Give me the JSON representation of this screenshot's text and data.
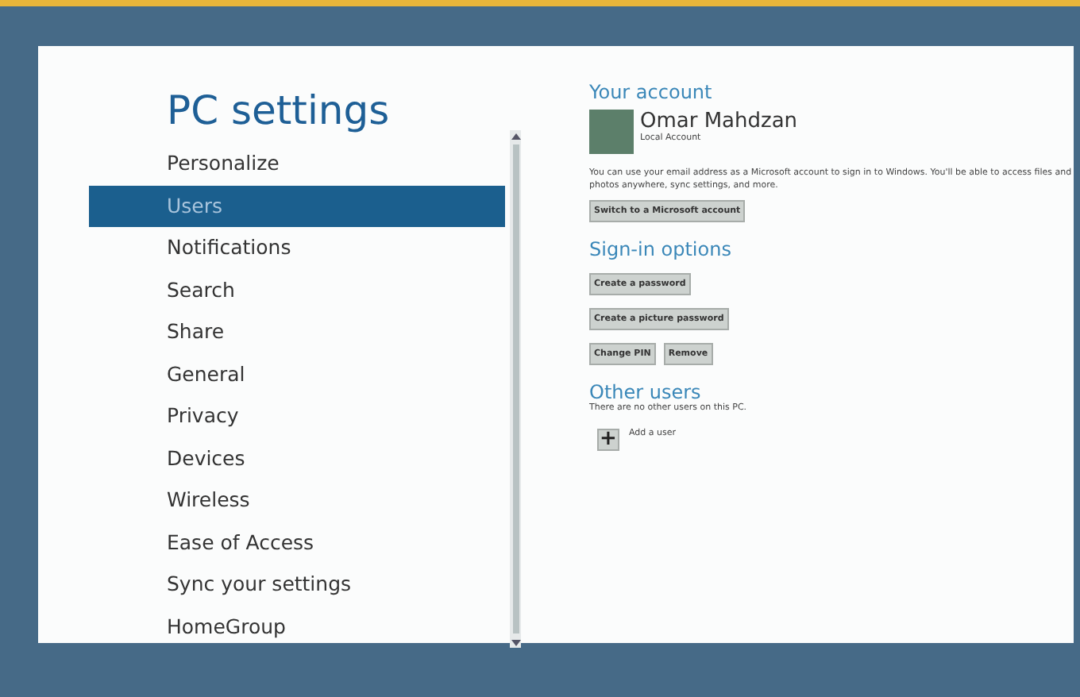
{
  "title": "PC settings",
  "nav": [
    {
      "label": "Personalize",
      "selected": false
    },
    {
      "label": "Users",
      "selected": true
    },
    {
      "label": "Notifications",
      "selected": false
    },
    {
      "label": "Search",
      "selected": false
    },
    {
      "label": "Share",
      "selected": false
    },
    {
      "label": "General",
      "selected": false
    },
    {
      "label": "Privacy",
      "selected": false
    },
    {
      "label": "Devices",
      "selected": false
    },
    {
      "label": "Wireless",
      "selected": false
    },
    {
      "label": "Ease of Access",
      "selected": false
    },
    {
      "label": "Sync your settings",
      "selected": false
    },
    {
      "label": "HomeGroup",
      "selected": false
    }
  ],
  "account": {
    "heading": "Your account",
    "name": "Omar Mahdzan",
    "type": "Local Account",
    "description": "You can use your email address as a Microsoft account to sign in to Windows. You'll be able to access files and photos anywhere, sync settings, and more.",
    "button": "Switch to a Microsoft account"
  },
  "signin": {
    "heading": "Sign-in options",
    "button_rows": [
      [
        "Create a password"
      ],
      [
        "Create a picture password"
      ],
      [
        "Change PIN",
        "Remove"
      ]
    ]
  },
  "other_users": {
    "heading": "Other users",
    "note": "There are no other users on this PC.",
    "add_icon": "+",
    "add_label": "Add a user"
  }
}
